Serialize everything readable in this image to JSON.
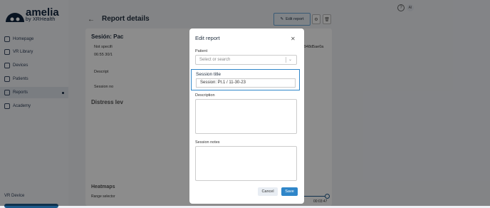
{
  "brand": {
    "name": "amelia",
    "sub": "by XRHealth"
  },
  "sidebar": {
    "items": [
      {
        "label": "Homepage"
      },
      {
        "label": "VR Library"
      },
      {
        "label": "Devices"
      },
      {
        "label": "Patients"
      },
      {
        "label": "Reports"
      },
      {
        "label": "Academy"
      }
    ],
    "vr_device_label": "VR Device"
  },
  "header": {
    "back": "←",
    "title": "Report details",
    "edit_button": "Edit report",
    "help": "?",
    "avatar": "AI"
  },
  "report": {
    "session_name": "Sesión: Pac",
    "not_specified": "Not specifi",
    "time": "06:55 30/1",
    "description_label": "Descript",
    "session_notes_label": "Session no",
    "hash": "74913f487db8d8e9e2a319e948d5ae0a",
    "distress_label": "Distress lev",
    "heatmaps": "Heatmaps",
    "range_selector": "Range selector",
    "end_time": "00:03:47"
  },
  "modal": {
    "title": "Edit report",
    "patient_label": "Patient",
    "patient_placeholder": "Select or search",
    "session_title_label": "Session title",
    "session_title_value": "Session: Pt.1      / 11-30-23",
    "description_label": "Description",
    "session_notes_label": "Session notes",
    "cancel": "Cancel",
    "save": "Save"
  },
  "colors": {
    "accent": "#2f86c9",
    "brand": "#10233d"
  }
}
